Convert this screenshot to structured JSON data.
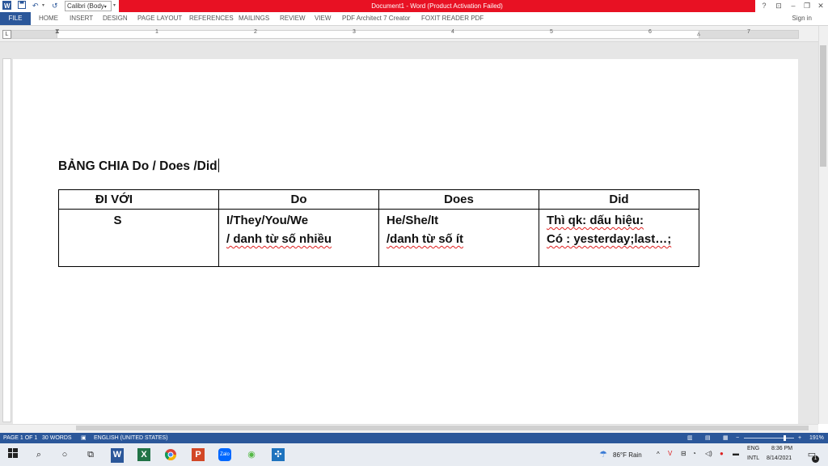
{
  "titlebar": {
    "font_name": "Calibri (Body",
    "window_title": "Document1 - Word (Product Activation Failed)",
    "help": "?",
    "minimize": "–",
    "restore": "❐",
    "close": "✕",
    "ribbon_options": "⊡"
  },
  "ribbon": {
    "tabs": [
      "FILE",
      "HOME",
      "INSERT",
      "DESIGN",
      "PAGE LAYOUT",
      "REFERENCES",
      "MAILINGS",
      "REVIEW",
      "VIEW",
      "PDF Architect 7 Creator",
      "FOXIT READER PDF"
    ],
    "sign_in": "Sign in"
  },
  "ruler": {
    "tab_selector": "L",
    "numbers": [
      "1",
      "2",
      "3",
      "4",
      "5",
      "6",
      "7"
    ]
  },
  "document": {
    "heading": "BẢNG CHIA Do / Does /Did",
    "table": {
      "headers": [
        "ĐI VỚI",
        "Do",
        "Does",
        "Did"
      ],
      "row": {
        "subject": "S",
        "do": [
          "I/They/You/We",
          "/ danh từ số nhiều"
        ],
        "does": [
          "He/She/It",
          "/danh từ số ít"
        ],
        "did": [
          "Thì qk: dấu hiệu:",
          "Có : yesterday;last…;"
        ]
      }
    }
  },
  "statusbar": {
    "page": "PAGE 1 OF 1",
    "words": "30 WORDS",
    "language": "ENGLISH (UNITED STATES)",
    "zoom": "191%",
    "zoom_level": 0.79
  },
  "taskbar": {
    "weather": "86°F Rain",
    "lang_top": "ENG",
    "lang_bottom": "INTL",
    "time": "8:36 PM",
    "date": "8/14/2021",
    "notification_count": "1"
  },
  "colors": {
    "word_blue": "#2b579a",
    "title_red": "#e81123",
    "spell_red": "#e02020"
  }
}
